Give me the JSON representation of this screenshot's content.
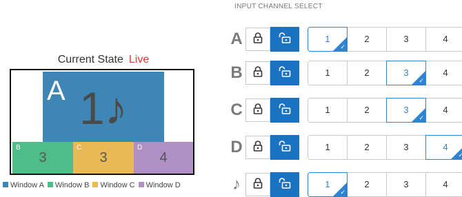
{
  "preview": {
    "title": "Current State",
    "status": "Live",
    "windows": {
      "a": {
        "letter": "A",
        "channel": "1♪"
      },
      "b": {
        "letter": "B",
        "channel": "3"
      },
      "c": {
        "letter": "C",
        "channel": "3"
      },
      "d": {
        "letter": "D",
        "channel": "4"
      }
    },
    "legend": [
      "Window A",
      "Window B",
      "Window C",
      "Window D"
    ]
  },
  "colors": {
    "window_a": "#3e86b5",
    "window_b": "#4fbd88",
    "window_c": "#e8b955",
    "window_d": "#b08fc5",
    "accent": "#1c72c2",
    "live": "#e53935"
  },
  "input_select": {
    "title": "INPUT CHANNEL SELECT",
    "rows": [
      {
        "label": "A",
        "lock_icon": "lock-icon",
        "unlock_icon": "unlock-icon",
        "channels": [
          "1",
          "2",
          "3",
          "4"
        ],
        "selected": "1"
      },
      {
        "label": "B",
        "lock_icon": "lock-icon",
        "unlock_icon": "unlock-icon",
        "channels": [
          "1",
          "2",
          "3",
          "4"
        ],
        "selected": "3"
      },
      {
        "label": "C",
        "lock_icon": "lock-icon",
        "unlock_icon": "unlock-icon",
        "channels": [
          "1",
          "2",
          "3",
          "4"
        ],
        "selected": "3"
      },
      {
        "label": "D",
        "lock_icon": "lock-icon",
        "unlock_icon": "unlock-icon",
        "channels": [
          "1",
          "2",
          "3",
          "4"
        ],
        "selected": "4"
      },
      {
        "label": "♪",
        "lock_icon": "lock-icon",
        "unlock_icon": "unlock-icon",
        "channels": [
          "1",
          "2",
          "3",
          "4"
        ],
        "selected": "1"
      }
    ]
  }
}
